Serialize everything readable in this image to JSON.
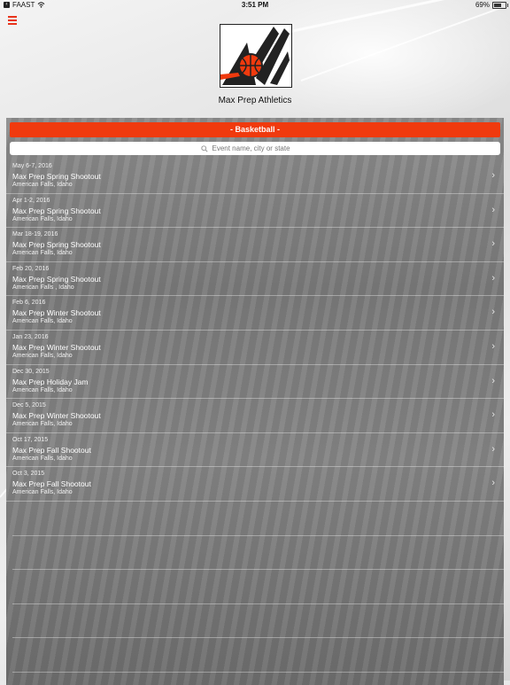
{
  "status": {
    "carrier": "FAAST",
    "time": "3:51 PM",
    "battery": "69%",
    "battery_level": 0.69
  },
  "header": {
    "org_name": "Max Prep Athletics"
  },
  "sport_selector": {
    "label": "- Basketball -"
  },
  "search": {
    "placeholder": "Event name, city or state"
  },
  "events": [
    {
      "date": "May 6-7, 2016",
      "name": "Max Prep Spring Shootout",
      "location": "American Falls, Idaho"
    },
    {
      "date": "Apr 1-2, 2016",
      "name": "Max Prep Spring Shootout",
      "location": "American Falls, Idaho"
    },
    {
      "date": "Mar 18-19, 2016",
      "name": "Max Prep Spring Shootout",
      "location": "American Falls, Idaho"
    },
    {
      "date": "Feb 20, 2016",
      "name": "Max Prep Spring Shootout",
      "location": "American Falls , Idaho"
    },
    {
      "date": "Feb 6, 2016",
      "name": "Max Prep Winter Shootout",
      "location": "American Falls, Idaho"
    },
    {
      "date": "Jan 23, 2016",
      "name": "Max Prep Winter Shootout",
      "location": "American Falls, Idaho"
    },
    {
      "date": "Dec 30, 2015",
      "name": "Max Prep Holiday Jam",
      "location": "American Falls, Idaho"
    },
    {
      "date": "Dec 5, 2015",
      "name": "Max Prep Winter Shootout",
      "location": "American Falls, Idaho"
    },
    {
      "date": "Oct 17, 2015",
      "name": "Max Prep Fall Shootout",
      "location": "American Falls, Idaho"
    },
    {
      "date": "Oct 3, 2015",
      "name": "Max Prep Fall Shootout",
      "location": "American Falls, Idaho"
    }
  ],
  "colors": {
    "accent": "#f03a0e",
    "menu": "#e8341c"
  },
  "icons": {
    "menu": "hamburger-icon",
    "search": "search-icon",
    "row": "chevron-right-icon",
    "wifi": "wifi-icon"
  }
}
